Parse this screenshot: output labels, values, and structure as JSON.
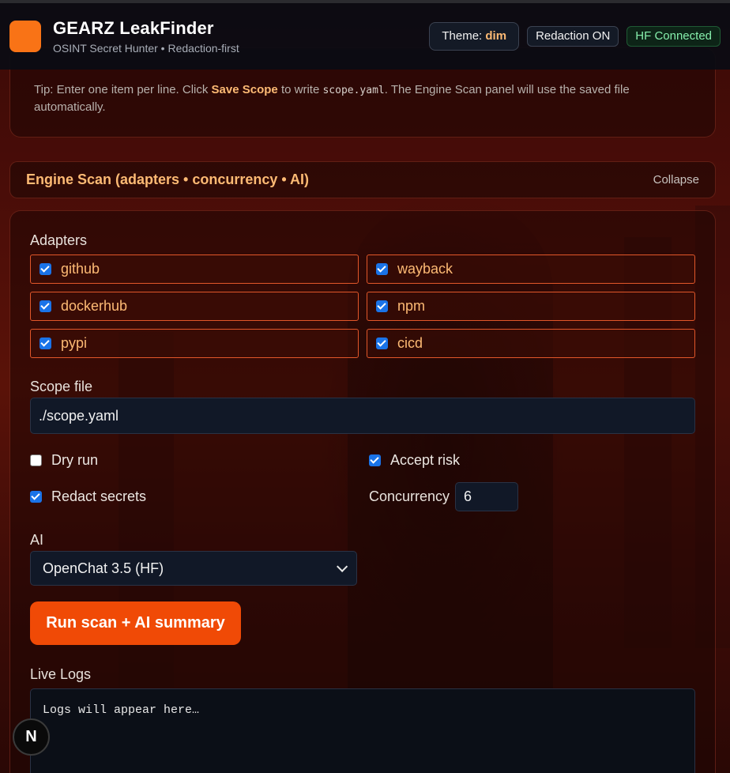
{
  "header": {
    "title": "GEARZ LeakFinder",
    "subtitle": "OSINT Secret Hunter • Redaction-first",
    "theme_label": "Theme:",
    "theme_value": "dim",
    "redaction": "Redaction ON",
    "hf_status": "HF Connected"
  },
  "scope_panel": {
    "tip_pre": "Tip: Enter one item per line. Click",
    "tip_bold": "Save Scope",
    "tip_mid": "to write",
    "tip_code": "scope.yaml",
    "tip_post": ". The Engine Scan panel will use the saved file automatically."
  },
  "engine": {
    "title": "Engine Scan (adapters • concurrency • AI)",
    "collapse": "Collapse",
    "adapters_label": "Adapters",
    "adapters": [
      {
        "name": "github",
        "checked": true
      },
      {
        "name": "wayback",
        "checked": true
      },
      {
        "name": "dockerhub",
        "checked": true
      },
      {
        "name": "npm",
        "checked": true
      },
      {
        "name": "pypi",
        "checked": true
      },
      {
        "name": "cicd",
        "checked": true
      }
    ],
    "scope_file_label": "Scope file",
    "scope_file_value": "./scope.yaml",
    "dry_run": "Dry run",
    "accept_risk": "Accept risk",
    "redact_secrets": "Redact secrets",
    "concurrency_label": "Concurrency",
    "concurrency_value": "6",
    "ai_label": "AI",
    "ai_selected": "OpenChat 3.5 (HF)",
    "run_button": "Run scan + AI summary",
    "live_logs_label": "Live Logs",
    "logs_placeholder": "Logs will appear here…"
  },
  "floating_badge": "N",
  "colors": {
    "accent": "#f97316",
    "run_button": "#f04a06",
    "section_title": "#fdba74",
    "hf_status": "#86efac"
  }
}
